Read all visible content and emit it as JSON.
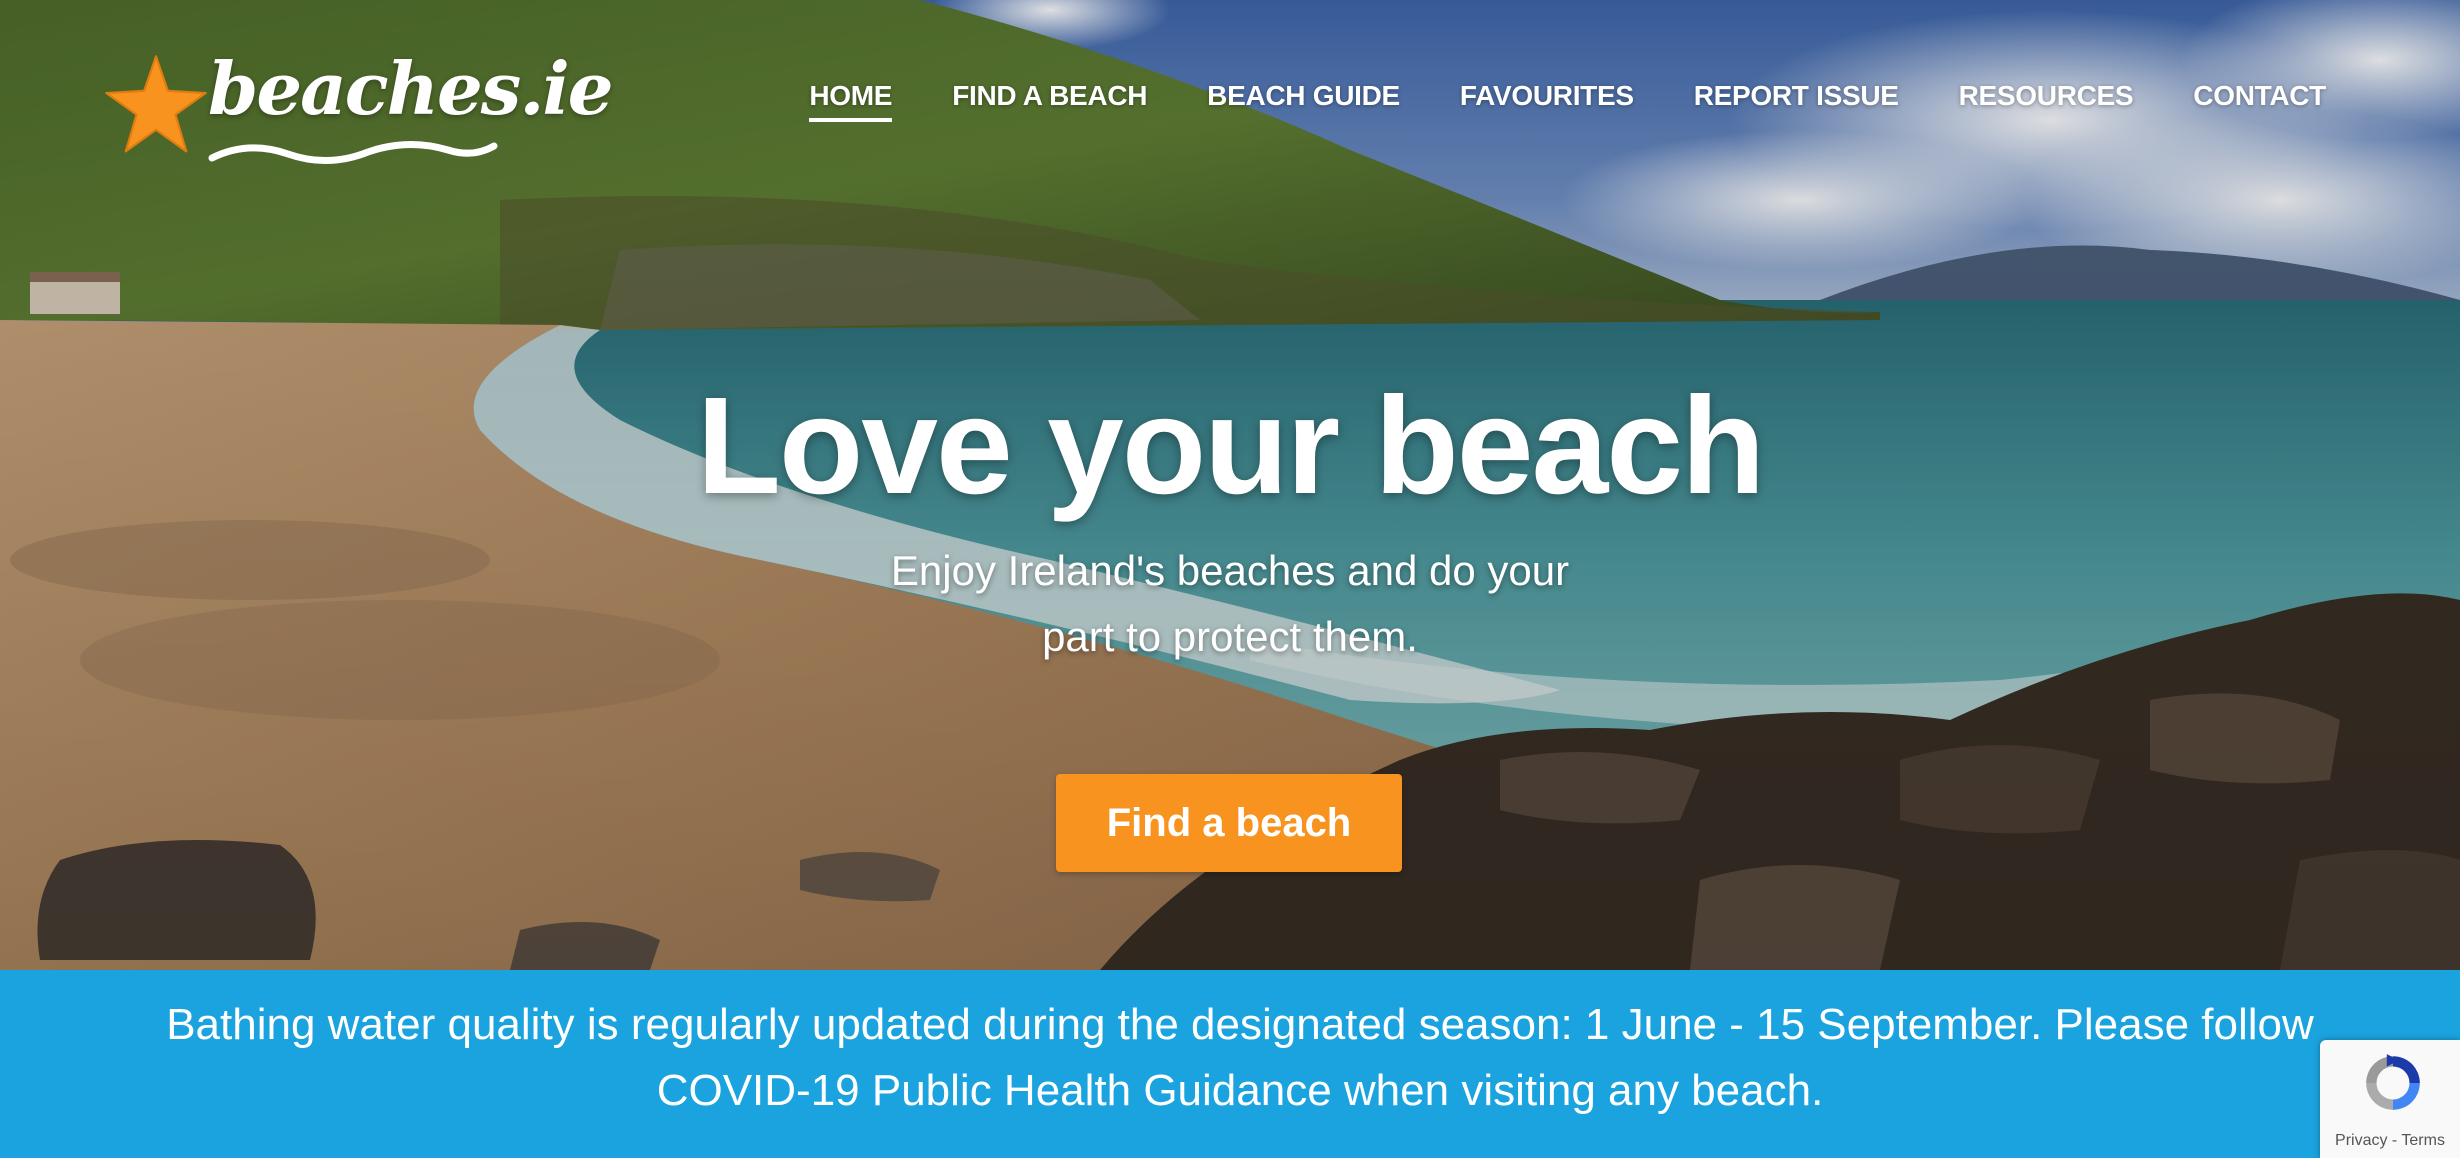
{
  "header": {
    "logo_text": "beaches.ie",
    "logo_icon": "starfish-icon",
    "nav": [
      {
        "label": "HOME",
        "active": true
      },
      {
        "label": "FIND A BEACH",
        "active": false
      },
      {
        "label": "BEACH GUIDE",
        "active": false
      },
      {
        "label": "FAVOURITES",
        "active": false
      },
      {
        "label": "REPORT ISSUE",
        "active": false
      },
      {
        "label": "RESOURCES",
        "active": false
      },
      {
        "label": "CONTACT",
        "active": false
      }
    ]
  },
  "hero": {
    "title": "Love your beach",
    "subtitle": "Enjoy Ireland's beaches and do your part to protect them.",
    "cta_label": "Find a beach"
  },
  "notice": {
    "text": "Bathing water quality is regularly updated during the designated season: 1 June - 15 September. Please follow COVID-19 Public Health Guidance when visiting any beach."
  },
  "recaptcha": {
    "privacy_label": "Privacy",
    "separator": " - ",
    "terms_label": "Terms",
    "icon": "recaptcha-icon"
  },
  "colors": {
    "accent_orange": "#f7931e",
    "notice_blue": "#1aa3de"
  }
}
